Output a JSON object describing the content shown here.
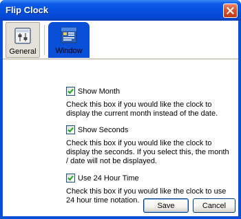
{
  "window": {
    "title": "Flip Clock"
  },
  "toolbar": {
    "items": [
      {
        "label": "General",
        "icon": "general-settings-icon",
        "selected": true
      },
      {
        "label": "Window",
        "icon": "window-settings-icon",
        "selected": false
      }
    ]
  },
  "options": [
    {
      "label": "Show Month",
      "checked": true,
      "description": "Check this box if you would like the clock to display the current month instead of the date."
    },
    {
      "label": "Show Seconds",
      "checked": true,
      "description": "Check this box if you would like the clock to display the seconds. If you select this, the month / date will not be displayed."
    },
    {
      "label": "Use 24 Hour Time",
      "checked": true,
      "description": "Check this box if you would like the clock to use 24 hour time notation."
    }
  ],
  "buttons": {
    "save": "Save",
    "cancel": "Cancel"
  },
  "colors": {
    "titlebar": "#0552e0",
    "dialog_face": "#ece9d8",
    "close_button": "#d8542f",
    "checkmark": "#21a121"
  }
}
